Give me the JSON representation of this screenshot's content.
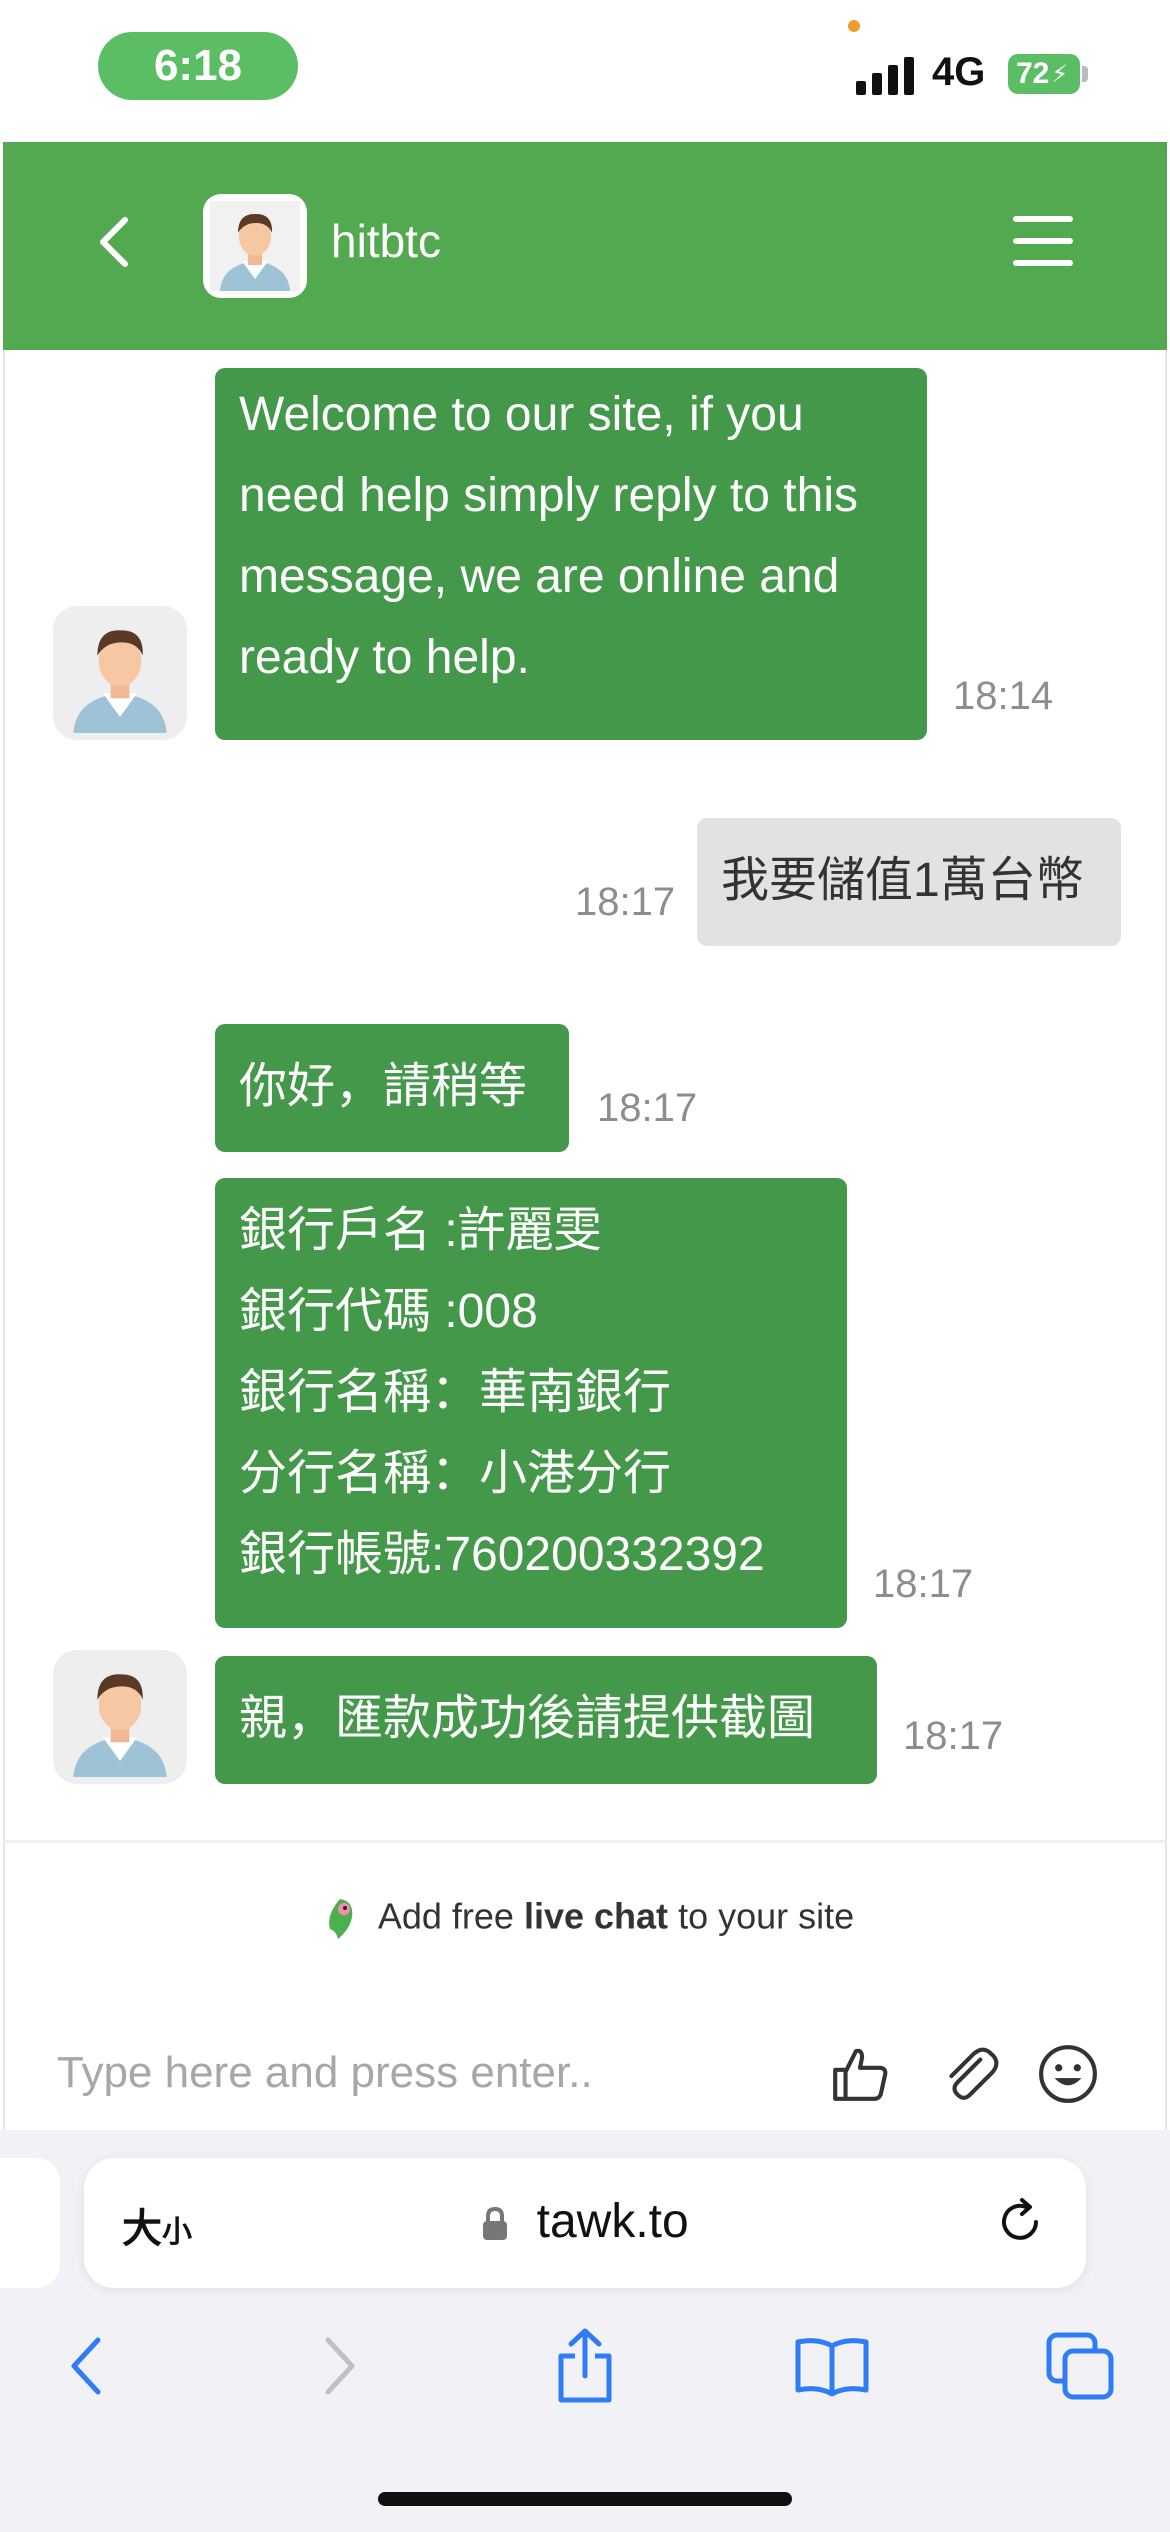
{
  "status_bar": {
    "time": "6:18",
    "network": "4G",
    "battery": "72"
  },
  "header": {
    "title": "hitbtc"
  },
  "messages": [
    {
      "sender": "agent",
      "text": "Welcome to our site, if you need help simply reply to this message, we are online and ready to help.",
      "time": "18:14"
    },
    {
      "sender": "visitor",
      "text": "我要儲值1萬台幣",
      "time": "18:17"
    },
    {
      "sender": "agent",
      "text": "你好，請稍等",
      "time": "18:17"
    },
    {
      "sender": "agent",
      "lines": [
        "銀行戶名 :許麗雯",
        "銀行代碼 :008",
        "銀行名稱：華南銀行",
        "分行名稱：小港分行",
        "銀行帳號:760200332392"
      ],
      "time": "18:17"
    },
    {
      "sender": "agent",
      "text": "親，匯款成功後請提供截圖",
      "time": "18:17"
    }
  ],
  "footer": {
    "branding_prefix": "Add free",
    "branding_bold": "live chat",
    "branding_suffix": "to your site",
    "input_placeholder": "Type here and press enter.."
  },
  "browser": {
    "size_label_big": "大",
    "size_label_small": "小",
    "url": "tawk.to"
  },
  "colors": {
    "header_green": "#53a950",
    "agent_bubble": "#44984a",
    "visitor_bubble": "#e2e2e2",
    "ios_blue": "#2f7cf6"
  },
  "icons": {
    "header": [
      "back-arrow-icon",
      "avatar",
      "hamburger-menu-icon"
    ],
    "composer": [
      "thumbs-up-icon",
      "paperclip-icon",
      "emoji-icon"
    ],
    "browser_toolbar": [
      "back-icon",
      "forward-icon",
      "share-icon",
      "bookmarks-icon",
      "tabs-icon"
    ]
  }
}
